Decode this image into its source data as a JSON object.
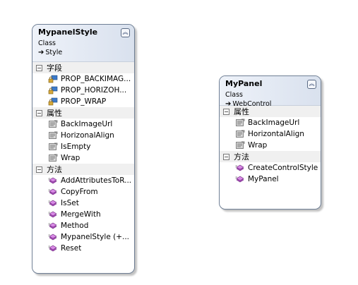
{
  "classes": [
    {
      "name": "MypanelStyle",
      "kind": "Class",
      "base": "Style",
      "sections": [
        {
          "title": "字段",
          "members": [
            {
              "label": "PROP_BACKIMAG...",
              "icon": "field-lock-icon"
            },
            {
              "label": "PROP_HORIZOH...",
              "icon": "field-lock-icon"
            },
            {
              "label": "PROP_WRAP",
              "icon": "field-lock-icon"
            }
          ]
        },
        {
          "title": "属性",
          "members": [
            {
              "label": "BackImageUrl",
              "icon": "property-icon"
            },
            {
              "label": "HorizonalAlign",
              "icon": "property-icon"
            },
            {
              "label": "IsEmpty",
              "icon": "property-icon"
            },
            {
              "label": "Wrap",
              "icon": "property-icon"
            }
          ]
        },
        {
          "title": "方法",
          "members": [
            {
              "label": "AddAttributesToR...",
              "icon": "method-icon"
            },
            {
              "label": "CopyFrom",
              "icon": "method-icon"
            },
            {
              "label": "IsSet",
              "icon": "method-icon"
            },
            {
              "label": "MergeWith",
              "icon": "method-icon"
            },
            {
              "label": "Method",
              "icon": "method-icon"
            },
            {
              "label": "MypanelStyle  (+...",
              "icon": "method-icon"
            },
            {
              "label": "Reset",
              "icon": "method-icon"
            }
          ]
        }
      ]
    },
    {
      "name": "MyPanel",
      "kind": "Class",
      "base": "WebControl",
      "sections": [
        {
          "title": "属性",
          "members": [
            {
              "label": "BackImageUrl",
              "icon": "property-icon"
            },
            {
              "label": "HorizontalAlign",
              "icon": "property-icon"
            },
            {
              "label": "Wrap",
              "icon": "property-icon"
            }
          ]
        },
        {
          "title": "方法",
          "members": [
            {
              "label": "CreateControlStyle",
              "icon": "method-icon"
            },
            {
              "label": "MyPanel",
              "icon": "method-icon"
            }
          ]
        }
      ]
    }
  ],
  "colors": {
    "method": "#b04fc4",
    "property": "#d8d8d8",
    "field": "#3c7acb",
    "lock": "#d6a93a"
  }
}
